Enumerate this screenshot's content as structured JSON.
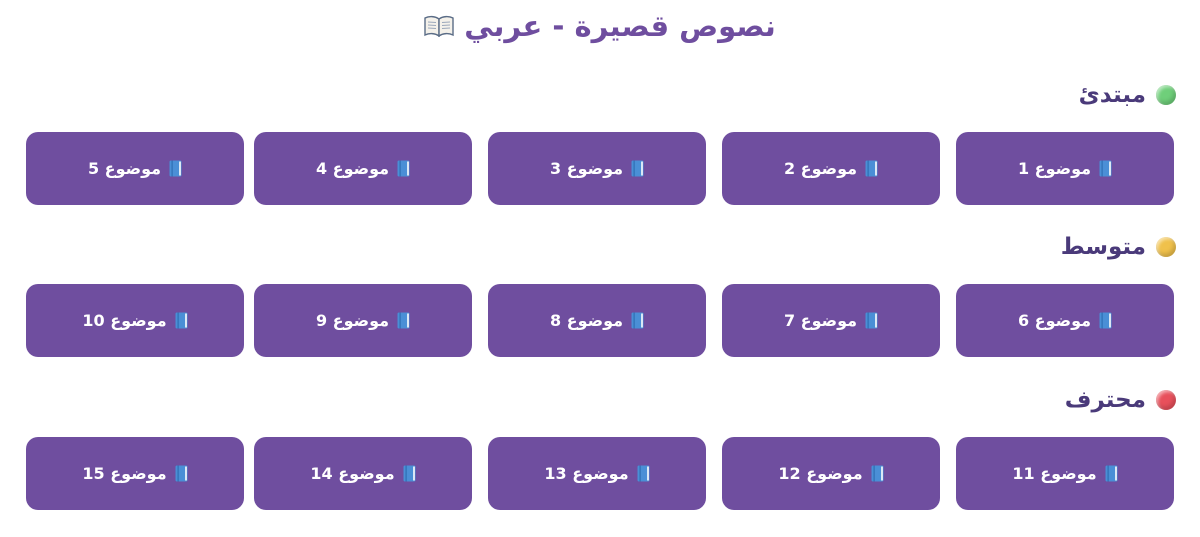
{
  "page": {
    "title": "نصوص قصيرة - عربي",
    "title_icon": "open-book-icon"
  },
  "colors": {
    "accent": "#6f4e9f",
    "button_text": "#ffffff",
    "beginner_dot": "#6fcf7a",
    "intermediate_dot": "#f0c14b",
    "advanced_dot": "#e8505b"
  },
  "sections": [
    {
      "title": "مبتدئ",
      "dot_icon": "green-circle-icon",
      "topics": [
        {
          "label": "موضوع 1",
          "icon": "blue-book-icon"
        },
        {
          "label": "موضوع 2",
          "icon": "blue-book-icon"
        },
        {
          "label": "موضوع 3",
          "icon": "blue-book-icon"
        },
        {
          "label": "موضوع 4",
          "icon": "blue-book-icon"
        },
        {
          "label": "موضوع 5",
          "icon": "blue-book-icon"
        }
      ]
    },
    {
      "title": "متوسط",
      "dot_icon": "yellow-circle-icon",
      "topics": [
        {
          "label": "موضوع 6",
          "icon": "blue-book-icon"
        },
        {
          "label": "موضوع 7",
          "icon": "blue-book-icon"
        },
        {
          "label": "موضوع 8",
          "icon": "blue-book-icon"
        },
        {
          "label": "موضوع 9",
          "icon": "blue-book-icon"
        },
        {
          "label": "موضوع 10",
          "icon": "blue-book-icon"
        }
      ]
    },
    {
      "title": "محترف",
      "dot_icon": "red-circle-icon",
      "topics": [
        {
          "label": "موضوع 11",
          "icon": "blue-book-icon"
        },
        {
          "label": "موضوع 12",
          "icon": "blue-book-icon"
        },
        {
          "label": "موضوع 13",
          "icon": "blue-book-icon"
        },
        {
          "label": "موضوع 14",
          "icon": "blue-book-icon"
        },
        {
          "label": "موضوع 15",
          "icon": "blue-book-icon"
        }
      ]
    }
  ]
}
